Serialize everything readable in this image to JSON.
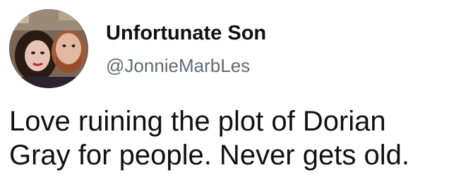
{
  "tweet": {
    "author": {
      "display_name": "Unfortunate Son",
      "handle": "@JonnieMarbLes",
      "avatar_icon": "user-avatar-photo"
    },
    "text_lines": [
      "Love ruining the plot of Dorian",
      "Gray for people. Never gets old."
    ]
  },
  "colors": {
    "background": "#ffffff",
    "text": "#111111",
    "handle": "#5f6b73"
  }
}
